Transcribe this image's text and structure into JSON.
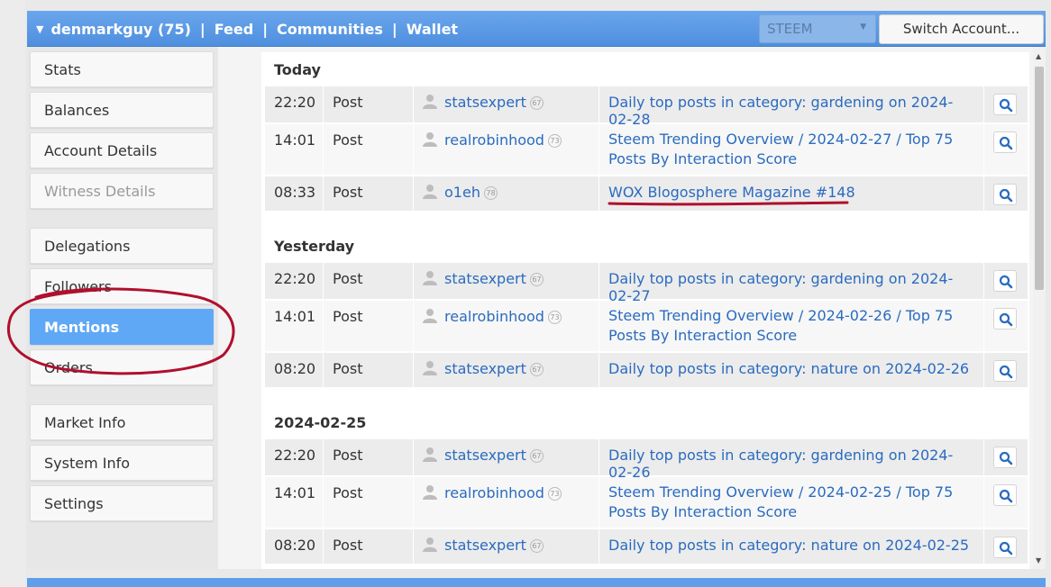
{
  "header": {
    "account": "denmarkguy (75)",
    "nav": [
      "Feed",
      "Communities",
      "Wallet"
    ],
    "currency": "STEEM",
    "switch_account": "Switch Account..."
  },
  "sidebar": {
    "items": [
      {
        "label": "Stats",
        "state": "normal"
      },
      {
        "label": "Balances",
        "state": "normal"
      },
      {
        "label": "Account Details",
        "state": "normal"
      },
      {
        "label": "Witness Details",
        "state": "disabled"
      },
      {
        "label": "Delegations",
        "state": "normal"
      },
      {
        "label": "Followers",
        "state": "normal"
      },
      {
        "label": "Mentions",
        "state": "active"
      },
      {
        "label": "Orders",
        "state": "normal"
      },
      {
        "label": "Market Info",
        "state": "normal"
      },
      {
        "label": "System Info",
        "state": "normal"
      },
      {
        "label": "Settings",
        "state": "normal"
      }
    ]
  },
  "mentions": {
    "groups": [
      {
        "title": "Today",
        "rows": [
          {
            "time": "22:20",
            "type": "Post",
            "user": "statsexpert",
            "rep": "67",
            "title": "Daily top posts in category: gardening on 2024-02-28"
          },
          {
            "time": "14:01",
            "type": "Post",
            "user": "realrobinhood",
            "rep": "73",
            "title": "Steem Trending Overview / 2024-02-27 / Top 75 Posts By Interaction Score"
          },
          {
            "time": "08:33",
            "type": "Post",
            "user": "o1eh",
            "rep": "78",
            "title": "WOX Blogosphere Magazine #148"
          }
        ]
      },
      {
        "title": "Yesterday",
        "rows": [
          {
            "time": "22:20",
            "type": "Post",
            "user": "statsexpert",
            "rep": "67",
            "title": "Daily top posts in category: gardening on 2024-02-27"
          },
          {
            "time": "14:01",
            "type": "Post",
            "user": "realrobinhood",
            "rep": "73",
            "title": "Steem Trending Overview / 2024-02-26 / Top 75 Posts By Interaction Score"
          },
          {
            "time": "08:20",
            "type": "Post",
            "user": "statsexpert",
            "rep": "67",
            "title": "Daily top posts in category: nature on 2024-02-26"
          }
        ]
      },
      {
        "title": "2024-02-25",
        "rows": [
          {
            "time": "22:20",
            "type": "Post",
            "user": "statsexpert",
            "rep": "67",
            "title": "Daily top posts in category: gardening on 2024-02-26"
          },
          {
            "time": "14:01",
            "type": "Post",
            "user": "realrobinhood",
            "rep": "73",
            "title": "Steem Trending Overview / 2024-02-25 / Top 75 Posts By Interaction Score"
          },
          {
            "time": "08:20",
            "type": "Post",
            "user": "statsexpert",
            "rep": "67",
            "title": "Daily top posts in category: nature on 2024-02-25"
          }
        ]
      }
    ]
  },
  "icons": {
    "user": "user-icon",
    "search": "search-icon",
    "caret": "caret-down-icon"
  },
  "colors": {
    "topbar": "#5a9be6",
    "active_item": "#5fa8f5",
    "link": "#2a6bbf",
    "annotation": "#b0102e"
  }
}
